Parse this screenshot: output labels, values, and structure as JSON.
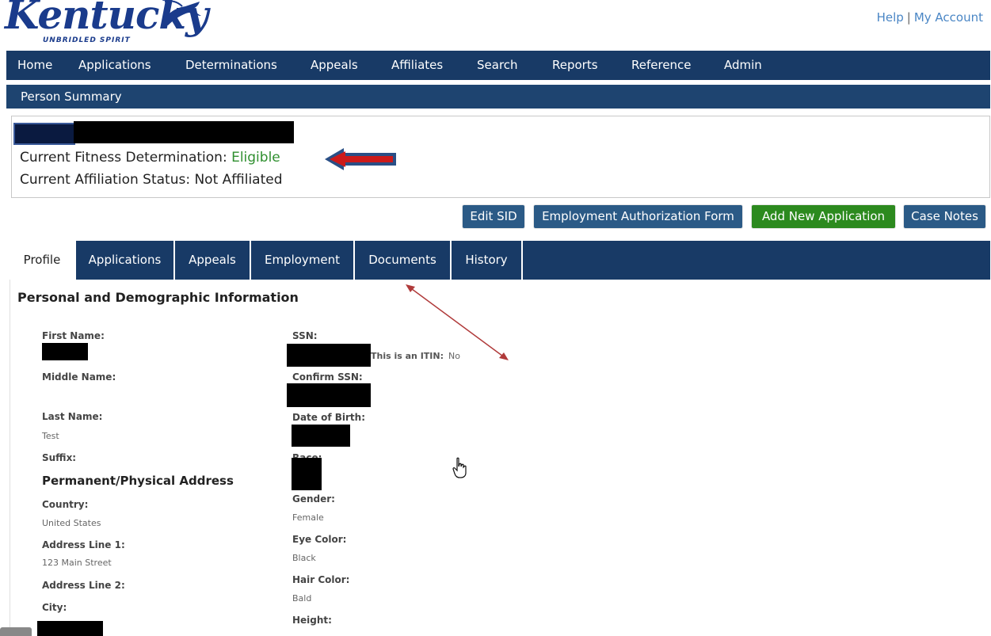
{
  "header": {
    "logo_text": "Kentucky",
    "logo_tagline": "UNBRIDLED SPIRIT",
    "links": {
      "help": "Help",
      "separator": "|",
      "my_account": "My Account"
    }
  },
  "nav": {
    "items": [
      "Home",
      "Applications",
      "Determinations",
      "Appeals",
      "Affiliates",
      "Search",
      "Reports",
      "Reference",
      "Admin"
    ]
  },
  "subnav": {
    "title": "Person Summary"
  },
  "summary": {
    "fitness_label": "Current Fitness Determination:",
    "fitness_value": "Eligible",
    "affiliation_label": "Current Affiliation Status:",
    "affiliation_value": "Not Affiliated"
  },
  "buttons": {
    "edit_sid": "Edit SID",
    "employment_auth": "Employment Authorization Form",
    "add_application": "Add New Application",
    "case_notes": "Case Notes"
  },
  "tabs": [
    "Profile",
    "Applications",
    "Appeals",
    "Employment",
    "Documents",
    "History"
  ],
  "active_tab": "Profile",
  "profile": {
    "section_title": "Personal and Demographic Information",
    "first_name_label": "First Name:",
    "middle_name_label": "Middle Name:",
    "last_name_label": "Last Name:",
    "last_name_value": "Test",
    "suffix_label": "Suffix:",
    "address_title": "Permanent/Physical Address",
    "country_label": "Country:",
    "country_value": "United States",
    "address1_label": "Address Line 1:",
    "address1_value": "123 Main Street",
    "address2_label": "Address Line 2:",
    "city_label": "City:",
    "ssn_label": "SSN:",
    "itin_label": "This is an ITIN:",
    "itin_value": "No",
    "confirm_ssn_label": "Confirm SSN:",
    "dob_label": "Date of Birth:",
    "race_label": "Race:",
    "gender_label": "Gender:",
    "gender_value": "Female",
    "eye_label": "Eye Color:",
    "eye_value": "Black",
    "hair_label": "Hair Color:",
    "hair_value": "Bald",
    "height_label": "Height:"
  },
  "colors": {
    "nav_bg": "#183a66",
    "button_blue": "#2b5a86",
    "button_green": "#2c8a1e",
    "eligible_green": "#2f8f2f",
    "annotation_red": "#cc1a1a"
  }
}
